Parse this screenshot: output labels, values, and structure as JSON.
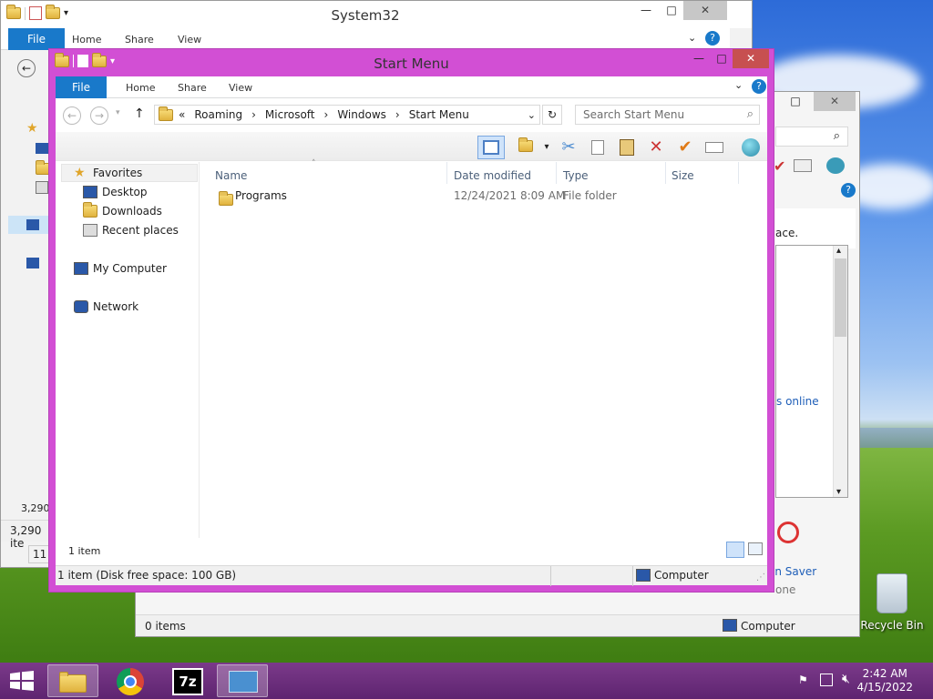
{
  "windows": {
    "system32": {
      "title": "System32",
      "tabs": [
        "File",
        "Home",
        "Share",
        "View"
      ],
      "status_count": "3,290",
      "status_items": "3,290 ite",
      "status_short": "11"
    },
    "control_panel": {
      "text_place": "ace.",
      "link_online": "s online",
      "screen_saver": "en Saver",
      "none": "one",
      "status_items": "0 items",
      "status_computer": "Computer"
    },
    "start_menu": {
      "title": "Start Menu",
      "tabs": [
        "File",
        "Home",
        "Share",
        "View"
      ],
      "breadcrumb": [
        "«",
        "Roaming",
        "›",
        "Microsoft",
        "›",
        "Windows",
        "›",
        "Start Menu"
      ],
      "search_placeholder": "Search Start Menu",
      "nav": {
        "favorites": "Favorites",
        "desktop": "Desktop",
        "downloads": "Downloads",
        "recent": "Recent places",
        "mycomputer": "My Computer",
        "network": "Network"
      },
      "columns": {
        "name": "Name",
        "date": "Date modified",
        "type": "Type",
        "size": "Size"
      },
      "rows": [
        {
          "name": "Programs",
          "date": "12/24/2021 8:09 AM",
          "type": "File folder",
          "size": ""
        }
      ],
      "item_count": "1 item",
      "status_left": "1 item (Disk free space: 100 GB)",
      "status_right": "Computer"
    }
  },
  "desktop": {
    "recycle_bin": "Recycle Bin"
  },
  "taskbar": {
    "time": "2:42 AM",
    "date": "4/15/2022",
    "app_7z": "7z"
  },
  "colors": {
    "accent": "#1979ca",
    "window_frame": "#d24fd4",
    "taskbar": "#6a2d78"
  }
}
